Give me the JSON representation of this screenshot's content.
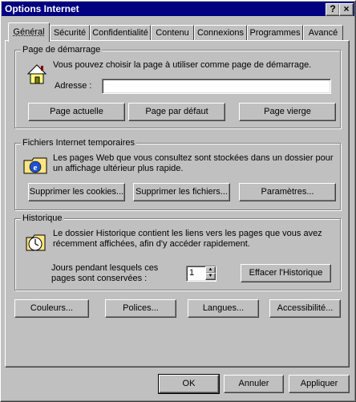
{
  "window": {
    "title": "Options Internet",
    "help_label": "?",
    "close_label": "×"
  },
  "tabs": [
    "Général",
    "Sécurité",
    "Confidentialité",
    "Contenu",
    "Connexions",
    "Programmes",
    "Avancé"
  ],
  "homepage": {
    "legend": "Page de démarrage",
    "description": "Vous pouvez choisir la page à utiliser comme page de démarrage.",
    "address_label": "Adresse :",
    "address_value": "",
    "buttons": [
      "Page actuelle",
      "Page par défaut",
      "Page vierge"
    ]
  },
  "temp_files": {
    "legend": "Fichiers Internet temporaires",
    "description_line1": "Les pages Web que vous consultez sont stockées dans un dossier pour",
    "description_line2": "un affichage ultérieur plus rapide.",
    "buttons": [
      "Supprimer les cookies...",
      "Supprimer les fichiers...",
      "Paramètres..."
    ]
  },
  "history": {
    "legend": "Historique",
    "description_line1": "Le dossier Historique contient les liens vers les pages que vous avez",
    "description_line2": "récemment affichées, afin d'y accéder rapidement.",
    "days_label_line1": "Jours pendant lesquels ces",
    "days_label_line2": "pages sont conservées :",
    "days_value": "1",
    "clear_button": "Effacer l'Historique"
  },
  "bottom_buttons": [
    "Couleurs...",
    "Polices...",
    "Langues...",
    "Accessibilité..."
  ],
  "dialog_buttons": {
    "ok": "OK",
    "cancel": "Annuler",
    "apply": "Appliquer"
  }
}
